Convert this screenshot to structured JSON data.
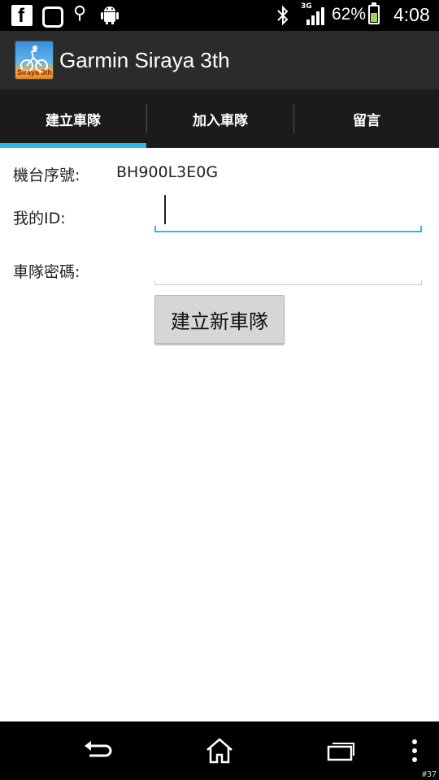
{
  "status_bar": {
    "icons": [
      "facebook-icon",
      "watch-icon",
      "usb-icon",
      "android-icon",
      "bluetooth-icon",
      "signal-icon",
      "battery-icon"
    ],
    "network": "3G",
    "battery_pct": "62%",
    "time": "4:08"
  },
  "app": {
    "title": "Garmin Siraya 3th",
    "icon_text": "Siraya 3th"
  },
  "tabs": [
    {
      "label": "建立車隊",
      "selected": true
    },
    {
      "label": "加入車隊",
      "selected": false
    },
    {
      "label": "留言",
      "selected": false
    }
  ],
  "form": {
    "serial_label": "機台序號:",
    "serial_value": "BH900L3E0G",
    "id_label": "我的ID:",
    "id_value": "",
    "password_label": "車隊密碼:",
    "password_value": "",
    "create_button": "建立新車隊"
  },
  "nav": {
    "icons": [
      "back-icon",
      "home-icon",
      "recent-apps-icon",
      "overflow-menu-icon"
    ],
    "footer": "#37"
  },
  "colors": {
    "accent": "#33b5e5",
    "action_bar": "#2b2b2b",
    "tab_bar": "#1b1b1b"
  }
}
